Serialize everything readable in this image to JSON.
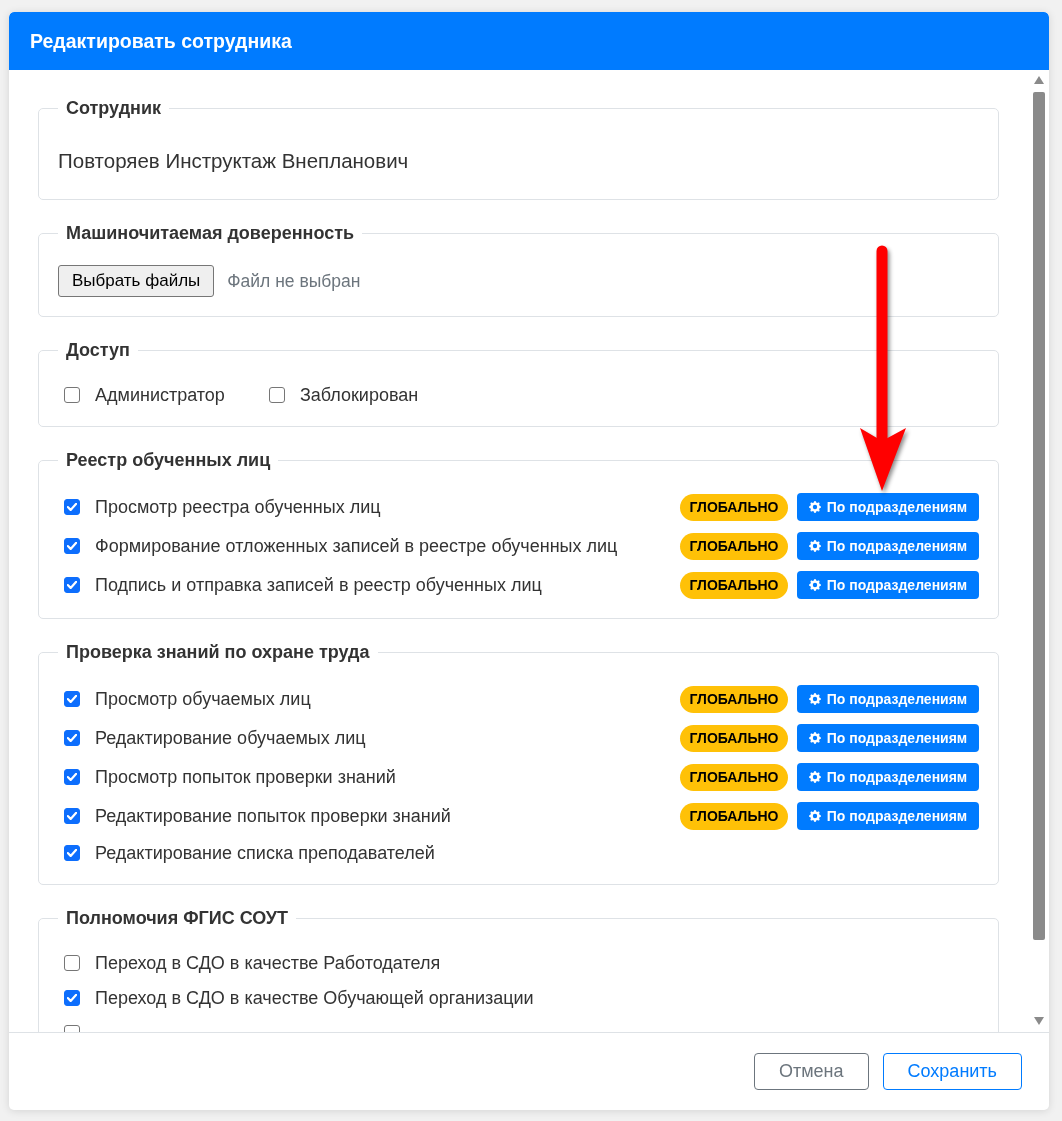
{
  "window": {
    "title": "Редактировать сотрудника"
  },
  "sections": [
    {
      "kind": "text",
      "legend": "Сотрудник",
      "value": "Повторяев Инструктаж Внепланович"
    },
    {
      "kind": "file",
      "legend": "Машиночитаемая доверенность",
      "button": "Выбрать файлы",
      "status": "Файл не выбран"
    },
    {
      "kind": "inline",
      "legend": "Доступ",
      "items": [
        {
          "label": "Администратор",
          "checked": false
        },
        {
          "label": "Заблокирован",
          "checked": false
        }
      ]
    },
    {
      "kind": "list",
      "legend": "Реестр обученных лиц",
      "items": [
        {
          "label": "Просмотр реестра обученных лиц",
          "checked": true,
          "badge": "ГЛОБАЛЬНО",
          "button": "По подразделениям"
        },
        {
          "label": "Формирование отложенных записей в реестре обученных лиц",
          "checked": true,
          "badge": "ГЛОБАЛЬНО",
          "button": "По подразделениям"
        },
        {
          "label": "Подпись и отправка записей в реестр обученных лиц",
          "checked": true,
          "badge": "ГЛОБАЛЬНО",
          "button": "По подразделениям"
        }
      ]
    },
    {
      "kind": "list",
      "legend": "Проверка знаний по охране труда",
      "items": [
        {
          "label": "Просмотр обучаемых лиц",
          "checked": true,
          "badge": "ГЛОБАЛЬНО",
          "button": "По подразделениям"
        },
        {
          "label": "Редактирование обучаемых лиц",
          "checked": true,
          "badge": "ГЛОБАЛЬНО",
          "button": "По подразделениям"
        },
        {
          "label": "Просмотр попыток проверки знаний",
          "checked": true,
          "badge": "ГЛОБАЛЬНО",
          "button": "По подразделениям"
        },
        {
          "label": "Редактирование попыток проверки знаний",
          "checked": true,
          "badge": "ГЛОБАЛЬНО",
          "button": "По подразделениям"
        },
        {
          "label": "Редактирование списка преподавателей",
          "checked": true
        }
      ]
    },
    {
      "kind": "list",
      "legend": "Полномочия ФГИС СОУТ",
      "items": [
        {
          "label": "Переход в СДО в качестве Работодателя",
          "checked": false
        },
        {
          "label": "Переход в СДО в качестве Обучающей организации",
          "checked": true
        },
        {
          "checked": false
        }
      ]
    }
  ],
  "footer": {
    "buttons": [
      {
        "label": "Отмена",
        "kind": "secondary"
      },
      {
        "label": "Сохранить",
        "kind": "primary"
      }
    ]
  }
}
